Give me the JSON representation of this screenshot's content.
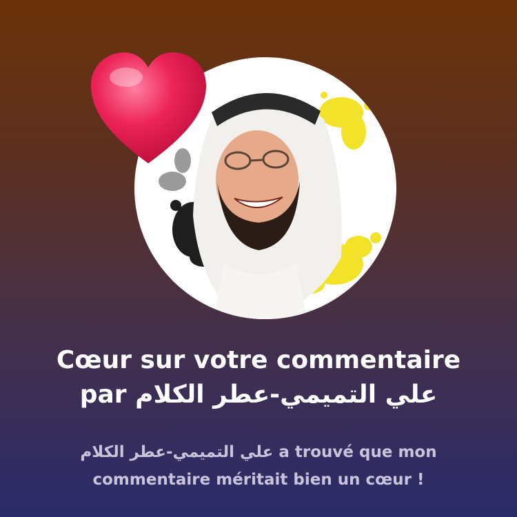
{
  "colors": {
    "background_top": "#6b3309",
    "background_bottom": "#2a2b6a",
    "heart": "#e8194f",
    "title_text": "#ffffff",
    "subtitle_text": "#c9c4dc",
    "splash_yellow": "#f2e22a"
  },
  "icons": {
    "heart": "heart-icon",
    "avatar": "commenter-avatar"
  },
  "title": {
    "line1": "Cœur sur votre commentaire",
    "line2_prefix": "par",
    "line2_name": "علي التميمي-عطر الكلام"
  },
  "subtitle": {
    "line1_name": "علي التميمي-عطر الكلام",
    "line1_suffix": "a trouvé que mon",
    "line2": "commentaire méritait bien un cœur !"
  }
}
